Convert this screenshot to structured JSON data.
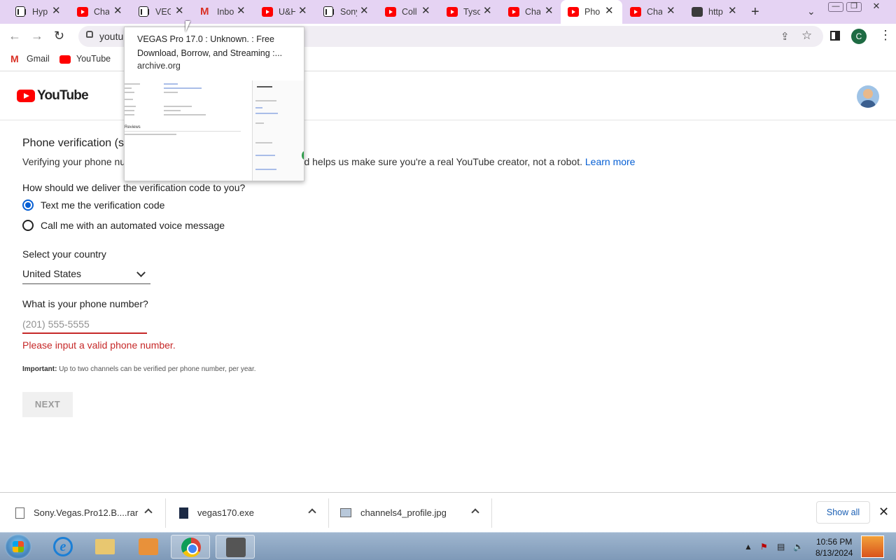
{
  "tabs": [
    {
      "label": "Hyp",
      "icon": "archive-icon"
    },
    {
      "label": "Cha",
      "icon": "youtube-icon"
    },
    {
      "label": "VEG",
      "icon": "archive-icon"
    },
    {
      "label": "Inbo",
      "icon": "gmail-icon"
    },
    {
      "label": "U&H",
      "icon": "youtube-icon"
    },
    {
      "label": "Sony",
      "icon": "archive-icon"
    },
    {
      "label": "Coll",
      "icon": "youtube-icon"
    },
    {
      "label": "Tyso",
      "icon": "youtube-icon"
    },
    {
      "label": "Cha",
      "icon": "youtube-icon"
    },
    {
      "label": "Pho",
      "icon": "youtube-icon",
      "active": true
    },
    {
      "label": "Cha",
      "icon": "youtube-icon"
    },
    {
      "label": "http",
      "icon": "page-icon"
    }
  ],
  "toolbar": {
    "url": "youtu",
    "profile_initial": "C"
  },
  "bookmarks": [
    {
      "label": "Gmail",
      "icon": "gmail-icon"
    },
    {
      "label": "YouTube",
      "icon": "youtube-icon"
    }
  ],
  "hover_card": {
    "title": "VEGAS Pro 17.0 : Unknown. : Free Download, Borrow, and Streaming :...",
    "domain": "archive.org",
    "thumb_reviews": "Reviews"
  },
  "header": {
    "logo_text": "YouTube"
  },
  "main": {
    "title": "Phone verification (s",
    "description": "Verifying your phone nu",
    "description_tail": "on YouTube, and helps us make sure you're a real YouTube creator, not a robot.",
    "learn_more": "Learn more",
    "deliver_question": "How should we deliver the verification code to you?",
    "options": [
      {
        "label": "Text me the verification code",
        "selected": true
      },
      {
        "label": "Call me with an automated voice message",
        "selected": false
      }
    ],
    "country_question": "Select your country",
    "country_value": "United States",
    "phone_question": "What is your phone number?",
    "phone_placeholder": "(201) 555-5555",
    "phone_value": "",
    "error": "Please input a valid phone number.",
    "note_label": "Important:",
    "note_text": "Up to two channels can be verified per phone number, per year.",
    "next_label": "NEXT"
  },
  "downloads": [
    {
      "name": "Sony.Vegas.Pro12.B....rar",
      "icon": "file-icon"
    },
    {
      "name": "vegas170.exe",
      "icon": "exe-icon"
    },
    {
      "name": "channels4_profile.jpg",
      "icon": "image-icon"
    }
  ],
  "download_bar": {
    "show_all": "Show all"
  },
  "taskbar": {
    "time": "10:56 PM",
    "date": "8/13/2024"
  },
  "colors": {
    "accent": "#065fd4",
    "error": "#c62828",
    "tabstrip": "#e5d3f3",
    "youtube_red": "#ff0000"
  }
}
